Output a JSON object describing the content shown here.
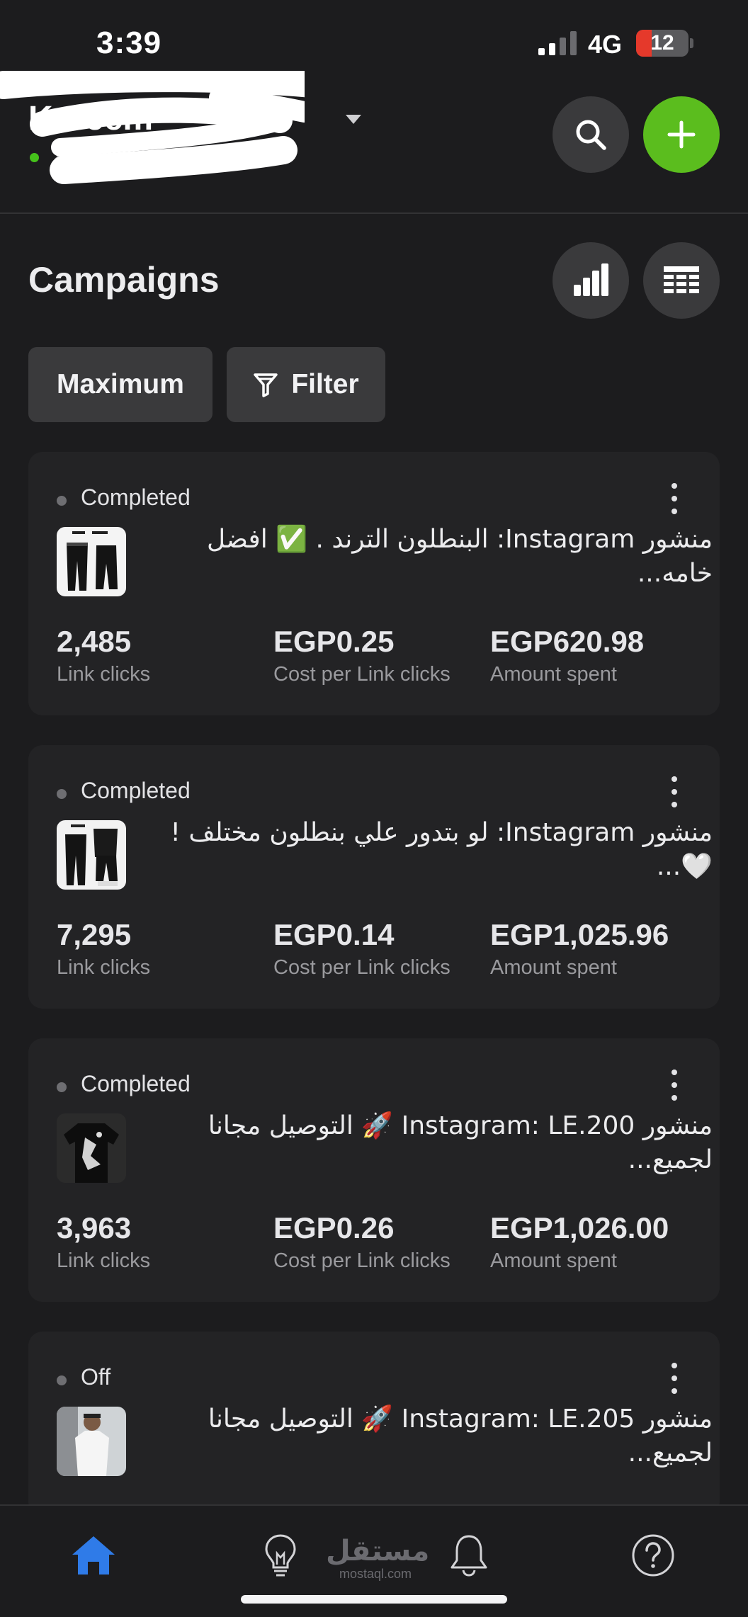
{
  "status_bar": {
    "time": "3:39",
    "network": "4G",
    "battery": "12",
    "battery_level": 0.12
  },
  "account": {
    "name": "Kareem",
    "subtitle": "2 active",
    "active_color": "#45c21b"
  },
  "header_actions": {
    "search_icon": "search-icon",
    "add_icon": "plus-icon",
    "add_color": "#5bbd1e"
  },
  "campaigns": {
    "title": "Campaigns",
    "view_buttons": [
      "bar-chart-icon",
      "table-icon"
    ],
    "sort_label": "Maximum",
    "filter_label": "Filter",
    "items": [
      {
        "status": "Completed",
        "title": "منشور Instagram: البنطلون الترند . ✅ افضل خامه...",
        "metrics": [
          {
            "value": "2,485",
            "label": "Link clicks"
          },
          {
            "value": "EGP0.25",
            "label": "Cost per Link clicks"
          },
          {
            "value": "EGP620.98",
            "label": "Amount spent"
          }
        ]
      },
      {
        "status": "Completed",
        "title": "منشور Instagram: لو بتدور علي بنطلون مختلف ! 🤍...",
        "metrics": [
          {
            "value": "7,295",
            "label": "Link clicks"
          },
          {
            "value": "EGP0.14",
            "label": "Cost per Link clicks"
          },
          {
            "value": "EGP1,025.96",
            "label": "Amount spent"
          }
        ]
      },
      {
        "status": "Completed",
        "title": "منشور Instagram: LE.200 🚀 التوصيل مجانا لجميع...",
        "metrics": [
          {
            "value": "3,963",
            "label": "Link clicks"
          },
          {
            "value": "EGP0.26",
            "label": "Cost per Link clicks"
          },
          {
            "value": "EGP1,026.00",
            "label": "Amount spent"
          }
        ]
      },
      {
        "status": "Off",
        "title": "منشور Instagram: LE.205 🚀 التوصيل مجانا لجميع..."
      }
    ]
  },
  "bottom_nav": {
    "items": [
      "home-icon",
      "lightbulb-icon",
      "bell-icon",
      "help-icon"
    ],
    "active_color": "#2f7be8"
  },
  "watermark": {
    "arabic": "مستقل",
    "latin": "mostaql.com"
  }
}
